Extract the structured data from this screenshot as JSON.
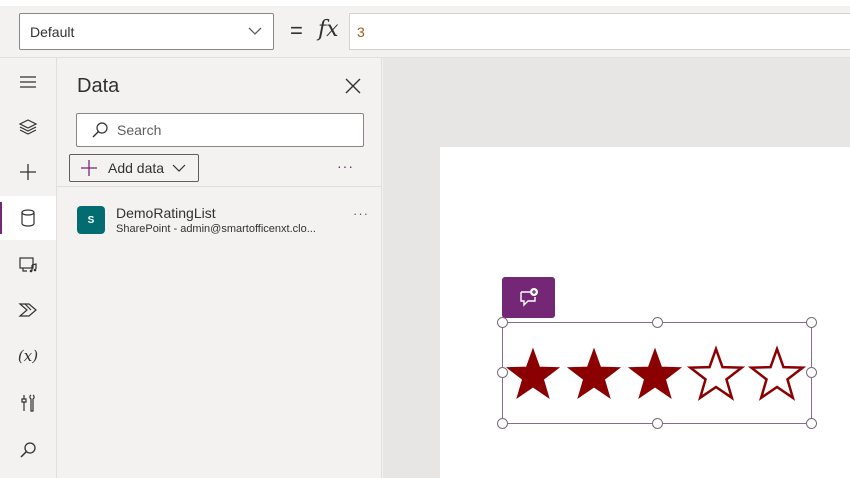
{
  "formula_bar": {
    "property": "Default",
    "equals": "=",
    "fx": "fx",
    "formula": "3"
  },
  "rail": {
    "items": [
      {
        "name": "hamburger-icon"
      },
      {
        "name": "layers-icon"
      },
      {
        "name": "plus-icon"
      },
      {
        "name": "database-icon",
        "active": true
      },
      {
        "name": "media-icon"
      },
      {
        "name": "power-automate-icon"
      },
      {
        "name": "variables-icon",
        "label": "(x)"
      },
      {
        "name": "tools-icon"
      },
      {
        "name": "search-icon"
      }
    ]
  },
  "data_pane": {
    "title": "Data",
    "search_placeholder": "Search",
    "add_data_label": "Add data",
    "more": "···",
    "sources": [
      {
        "name": "DemoRatingList",
        "subtitle": "SharePoint - admin@smartofficenxt.clo...",
        "icon_letter": "S",
        "more": "···"
      }
    ]
  },
  "rating": {
    "value": 3,
    "max": 5,
    "color": "#8b0000"
  },
  "colors": {
    "accent": "#742774",
    "star": "#8b0000",
    "formula_text": "#a35a1c"
  }
}
